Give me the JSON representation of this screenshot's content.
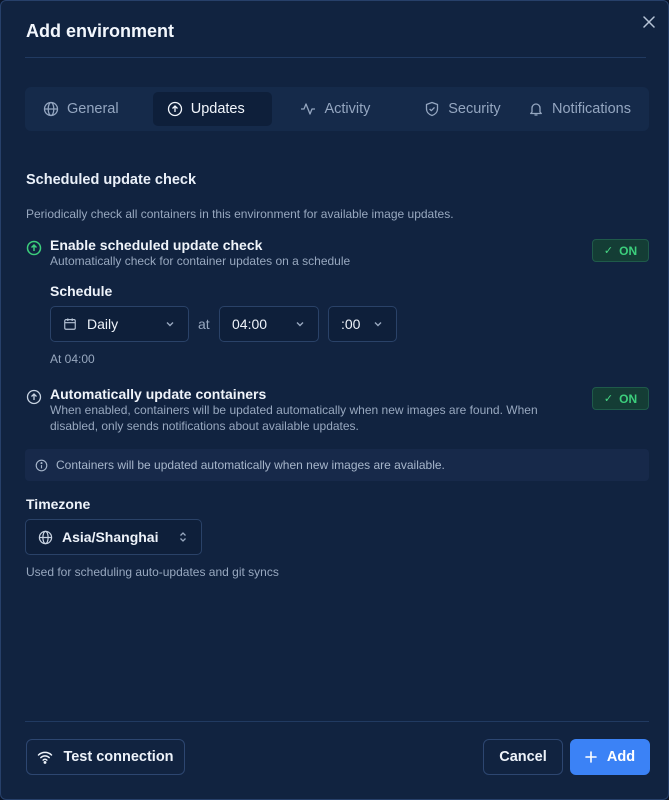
{
  "dialog": {
    "title": "Add environment"
  },
  "tabs": [
    {
      "label": "General",
      "icon": "globe-icon"
    },
    {
      "label": "Updates",
      "icon": "circle-arrow-up-icon",
      "active": true
    },
    {
      "label": "Activity",
      "icon": "activity-icon"
    },
    {
      "label": "Security",
      "icon": "shield-icon"
    },
    {
      "label": "Notifications",
      "icon": "bell-icon"
    }
  ],
  "section": {
    "title": "Scheduled update check",
    "description": "Periodically check all containers in this environment for available image updates."
  },
  "scheduled_check": {
    "title": "Enable scheduled update check",
    "subtitle": "Automatically check for container updates on a schedule",
    "toggle_label": "ON",
    "enabled": true
  },
  "schedule": {
    "label": "Schedule",
    "frequency": "Daily",
    "at_label": "at",
    "hour": "04:00",
    "minute": ":00",
    "note": "At 04:00"
  },
  "auto_update": {
    "title": "Automatically update containers",
    "subtitle": "When enabled, containers will be updated automatically when new images are found. When disabled, only sends notifications about available updates.",
    "toggle_label": "ON",
    "enabled": true
  },
  "info_banner": {
    "text": "Containers will be updated automatically when new images are available."
  },
  "timezone": {
    "label": "Timezone",
    "value": "Asia/Shanghai",
    "help": "Used for scheduling auto-updates and git syncs"
  },
  "footer": {
    "test_connection": "Test connection",
    "cancel": "Cancel",
    "add": "Add"
  },
  "colors": {
    "background": "#112340",
    "accent": "#3b82f6",
    "toggle_on": "#3ccf7c"
  }
}
